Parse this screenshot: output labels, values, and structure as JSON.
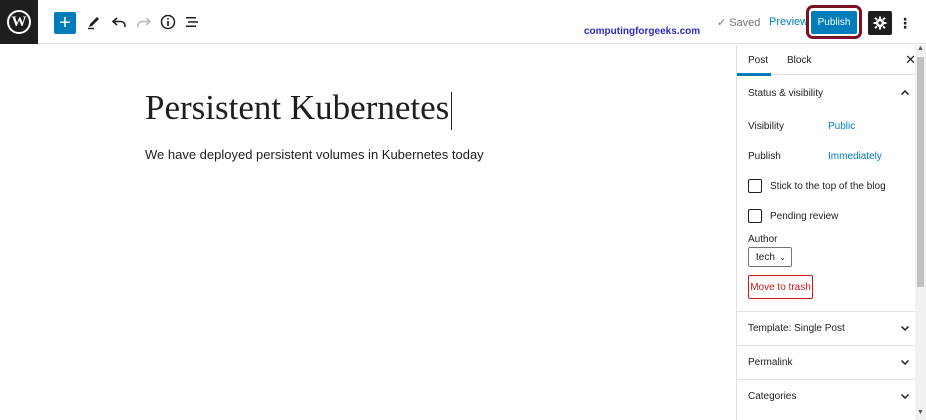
{
  "toolbar": {
    "add_block_symbol": "+",
    "saved_label": "Saved",
    "preview_label": "Preview",
    "publish_label": "Publish",
    "accent_color": "#007cba",
    "highlight_ring_color": "#7a1028"
  },
  "watermark": "computingforgeeks.com",
  "editor": {
    "title": "Persistent Kubernetes",
    "body": "We have deployed persistent volumes in Kubernetes today"
  },
  "sidebar": {
    "tabs": [
      {
        "label": "Post",
        "active": true
      },
      {
        "label": "Block",
        "active": false
      }
    ],
    "status_panel": {
      "heading": "Status & visibility",
      "visibility_label": "Visibility",
      "visibility_value": "Public",
      "publish_label": "Publish",
      "publish_value": "Immediately",
      "sticky_label": "Stick to the top of the blog",
      "sticky_checked": false,
      "pending_label": "Pending review",
      "pending_checked": false,
      "author_label": "Author",
      "author_value": "tech",
      "trash_label": "Move to trash"
    },
    "panels": [
      {
        "label": "Template: Single Post"
      },
      {
        "label": "Permalink"
      },
      {
        "label": "Categories"
      }
    ]
  }
}
